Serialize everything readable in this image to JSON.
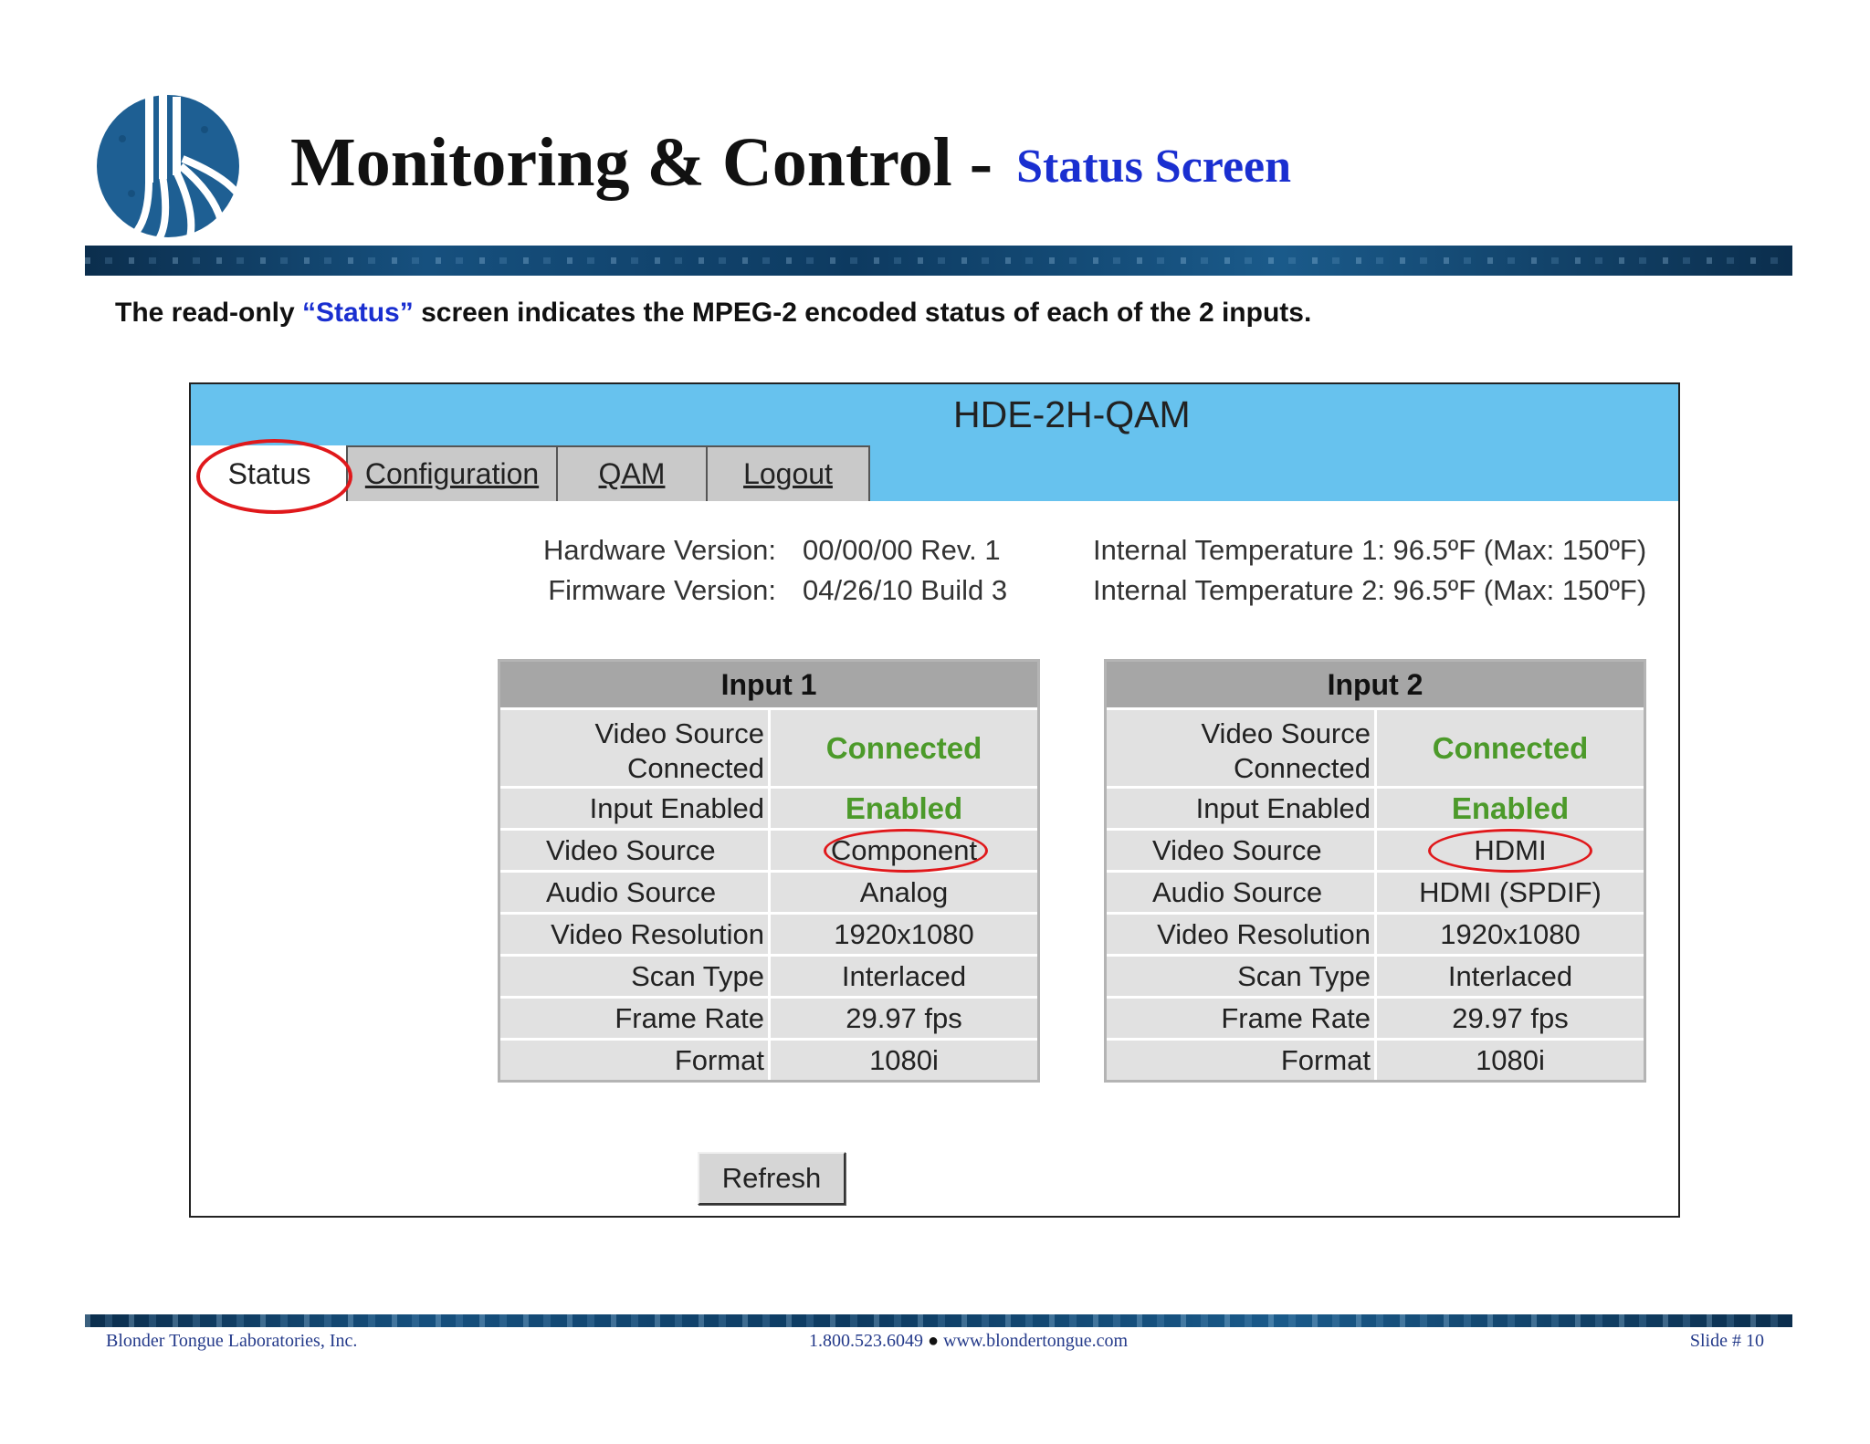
{
  "slide": {
    "title": "Monitoring & Control -",
    "subtitle": "Status Screen",
    "intro_pre": "The read-only ",
    "intro_highlight": "“Status”",
    "intro_post": " screen indicates the MPEG-2 encoded status of each of the 2 inputs."
  },
  "device": {
    "name": "HDE-2H-QAM",
    "tabs": [
      {
        "label": "Status",
        "active": true
      },
      {
        "label": "Configuration"
      },
      {
        "label": "QAM"
      },
      {
        "label": "Logout"
      }
    ],
    "hardware_label": "Hardware Version:",
    "hardware_value": "00/00/00 Rev. 1",
    "firmware_label": "Firmware Version:",
    "firmware_value": "04/26/10 Build 3",
    "temp1": "Internal Temperature 1: 96.5ºF (Max: 150ºF)",
    "temp2": "Internal Temperature 2: 96.5ºF (Max: 150ºF)",
    "refresh_label": "Refresh"
  },
  "inputs": [
    {
      "title": "Input 1",
      "rows": [
        {
          "label": "Video Source Connected",
          "value": "Connected"
        },
        {
          "label": "Input Enabled",
          "value": "Enabled"
        },
        {
          "label": "Video Source",
          "value": "Component"
        },
        {
          "label": "Audio Source",
          "value": "Analog"
        },
        {
          "label": "Video Resolution",
          "value": "1920x1080"
        },
        {
          "label": "Scan Type",
          "value": "Interlaced"
        },
        {
          "label": "Frame Rate",
          "value": "29.97 fps"
        },
        {
          "label": "Format",
          "value": "1080i"
        }
      ]
    },
    {
      "title": "Input 2",
      "rows": [
        {
          "label": "Video Source Connected",
          "value": "Connected"
        },
        {
          "label": "Input Enabled",
          "value": "Enabled"
        },
        {
          "label": "Video Source",
          "value": "HDMI"
        },
        {
          "label": "Audio Source",
          "value": "HDMI (SPDIF)"
        },
        {
          "label": "Video Resolution",
          "value": "1920x1080"
        },
        {
          "label": "Scan Type",
          "value": "Interlaced"
        },
        {
          "label": "Frame Rate",
          "value": "29.97 fps"
        },
        {
          "label": "Format",
          "value": "1080i"
        }
      ]
    }
  ],
  "footer": {
    "company": "Blonder Tongue Laboratories, Inc.",
    "phone": "1.800.523.6049",
    "website": "www.blondertongue.com",
    "slide_number": "Slide # 10"
  },
  "colors": {
    "header_blue": "#67c2ee",
    "title_accent": "#1a2fd0",
    "status_green": "#4c9a2a",
    "highlight_red": "#e0181b"
  },
  "icons": {
    "logo": "blonder-tongue-logo-icon",
    "footer_bullet": "bullet-icon"
  }
}
